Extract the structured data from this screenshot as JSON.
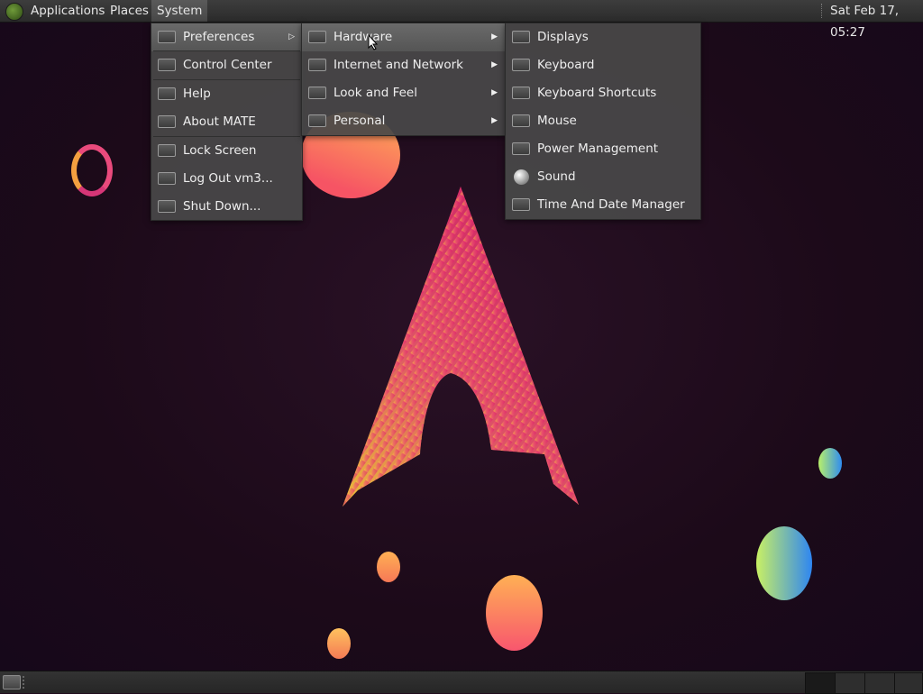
{
  "top_panel": {
    "menus": [
      "Applications",
      "Places",
      "System"
    ],
    "clock": "Sat Feb 17, 05:27"
  },
  "system_menu": {
    "items": [
      "Preferences",
      "Control Center",
      "Help",
      "About MATE",
      "Lock Screen",
      "Log Out vm3...",
      "Shut Down..."
    ]
  },
  "preferences_menu": {
    "items": [
      "Hardware",
      "Internet and Network",
      "Look and Feel",
      "Personal"
    ]
  },
  "hardware_menu": {
    "items": [
      "Displays",
      "Keyboard",
      "Keyboard Shortcuts",
      "Mouse",
      "Power Management",
      "Sound",
      "Time And Date Manager"
    ]
  },
  "icons": {
    "panel": "mate-logo-icon",
    "menu_item": "settings-app-icon",
    "sound": "speaker-sphere-icon",
    "submenu": "chevron-right-icon",
    "show_desktop": "desktop-icon"
  },
  "colors": {
    "menu_bg": "#484848",
    "highlight": "#606060",
    "accent": "#e4286e"
  }
}
